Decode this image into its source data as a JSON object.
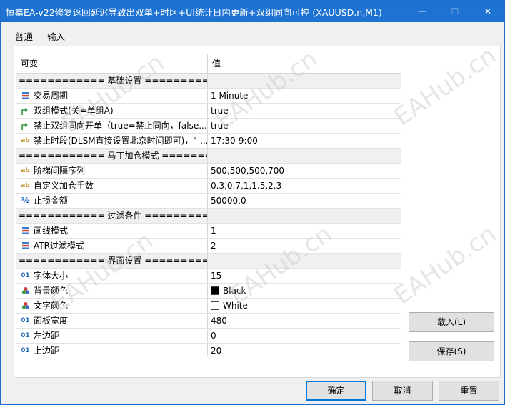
{
  "window": {
    "title": "恒鑫EA-v22修复返回延迟导致出双单+时区+UI统计日内更新+双组同向可控 (XAUUSD.n,M1)",
    "minimize_glyph": "—",
    "maximize_glyph": "☐",
    "close_glyph": "✕"
  },
  "tabs": [
    {
      "label": "普通"
    },
    {
      "label": "输入"
    }
  ],
  "grid": {
    "headers": {
      "name": "可变",
      "value": "值"
    },
    "rows": [
      {
        "type": "section",
        "name": "============ 基础设置 ==========..."
      },
      {
        "type": "param",
        "icon": "enum-icon",
        "name": "交易周期",
        "value": "1 Minute"
      },
      {
        "type": "param",
        "icon": "bool-icon",
        "name": "双组模式(关=单组A)",
        "value": "true"
      },
      {
        "type": "param",
        "icon": "bool-icon",
        "name": "禁止双组同向开单（true=禁止同向，false...",
        "value": "true"
      },
      {
        "type": "param",
        "icon": "string-icon",
        "name": "禁止时段(DLSM直接设置北京时间即可)，\"-...",
        "value": "17:30-9:00"
      },
      {
        "type": "section",
        "name": "============ 马丁加仓模式 ========..."
      },
      {
        "type": "param",
        "icon": "string-icon",
        "name": "阶梯间隔序列",
        "value": "500,500,500,700"
      },
      {
        "type": "param",
        "icon": "string-icon",
        "name": "自定义加仓手数",
        "value": "0.3,0.7,1,1.5,2.3"
      },
      {
        "type": "param",
        "icon": "double-icon",
        "name": "止损金额",
        "value": "50000.0"
      },
      {
        "type": "section",
        "name": "============ 过滤条件 ==========..."
      },
      {
        "type": "param",
        "icon": "enum-icon",
        "name": "画线模式",
        "value": "1"
      },
      {
        "type": "param",
        "icon": "enum-icon",
        "name": "ATR过滤模式",
        "value": "2"
      },
      {
        "type": "section",
        "name": "============ 界面设置 ==========..."
      },
      {
        "type": "param",
        "icon": "int-icon",
        "name": "字体大小",
        "value": "15"
      },
      {
        "type": "param",
        "icon": "color-icon",
        "name": "背景颜色",
        "value": "Black",
        "swatch": "#000000"
      },
      {
        "type": "param",
        "icon": "color-icon",
        "name": "文字颜色",
        "value": "White",
        "swatch": "#ffffff"
      },
      {
        "type": "param",
        "icon": "int-icon",
        "name": "面板宽度",
        "value": "480"
      },
      {
        "type": "param",
        "icon": "int-icon",
        "name": "左边距",
        "value": "0"
      },
      {
        "type": "param",
        "icon": "int-icon",
        "name": "上边距",
        "value": "20"
      }
    ]
  },
  "side_buttons": {
    "load": "载入(L)",
    "save": "保存(S)"
  },
  "footer_buttons": {
    "ok": "确定",
    "cancel": "取消",
    "reset": "重置"
  },
  "watermark": "EAHub.cn",
  "colors": {
    "titlebar": "#1e73d2",
    "accent": "#0078d7",
    "section_bg": "#f0f0f0"
  }
}
